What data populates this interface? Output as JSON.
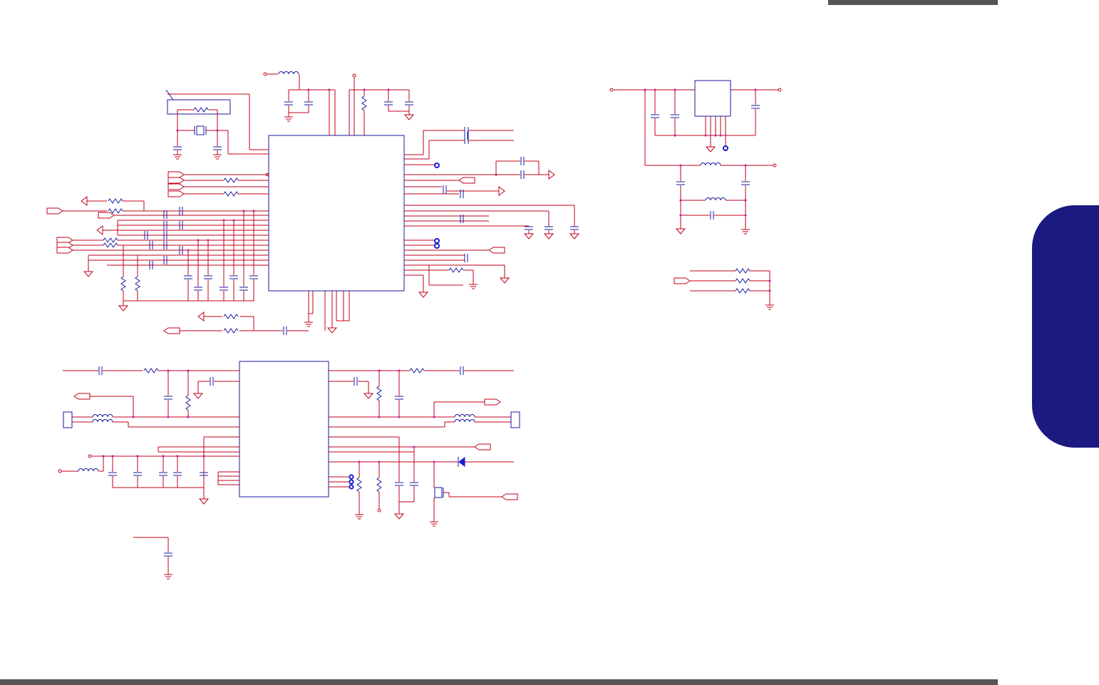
{
  "page": {
    "accent_colors": {
      "wire": "#c0001a",
      "part": "#1a1aa0",
      "junction": "#c030a0",
      "side_tab": "#1a1a80",
      "bars": "#555555"
    }
  },
  "diagram": {
    "type": "electrical-schematic",
    "blocks": [
      "main-ic-section",
      "lower-ic-section",
      "regulator-section",
      "resistor-array-section"
    ],
    "labels": []
  }
}
